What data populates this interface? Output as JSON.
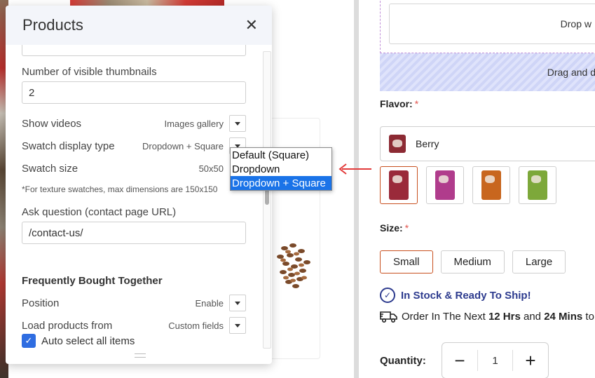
{
  "panel": {
    "title": "Products",
    "close_glyph": "✕",
    "thumbnails": {
      "label": "Number of visible thumbnails",
      "value": "2"
    },
    "show_videos": {
      "label": "Show videos",
      "value": "Images gallery"
    },
    "swatch_type": {
      "label": "Swatch display type",
      "value": "Dropdown + Square"
    },
    "swatch_size": {
      "label": "Swatch size",
      "value": "50x50"
    },
    "note": "*For texture swatches, max dimensions are 150x150",
    "ask_question": {
      "label": "Ask question (contact page URL)",
      "value": "/contact-us/"
    },
    "fbt": {
      "heading": "Frequently Bought Together",
      "position": {
        "label": "Position",
        "value": "Enable"
      },
      "load_from": {
        "label": "Load products from",
        "value": "Custom fields"
      },
      "auto_select": {
        "label": "Auto select all items",
        "checked": true
      }
    }
  },
  "dropdown": {
    "options": [
      "Default (Square)",
      "Dropdown",
      "Dropdown + Square"
    ],
    "selected_index": 2
  },
  "storefront": {
    "drop_text": "Drop w",
    "drag_text": "Drag and d",
    "flavor_label": "Flavor:",
    "required_mark": "*",
    "flavor_value": "Berry",
    "size_label": "Size:",
    "sizes": [
      "Small",
      "Medium",
      "Large"
    ],
    "selected_size": "Small",
    "stock_text": "In Stock & Ready To Ship!",
    "order": {
      "prefix": "Order In The Next",
      "hours": "12 Hrs",
      "and": "and",
      "mins": "24 Mins",
      "suffix": "to s"
    },
    "quantity_label": "Quantity:",
    "quantity_value": "1",
    "minus": "−",
    "plus": "+"
  },
  "colors": {
    "accent_blue": "#2f6de1",
    "selection_highlight": "#1a73e8",
    "arrow_red": "#e23b3b",
    "stock_blue": "#2d3b8e",
    "selected_border": "#c8501f",
    "swatch_colors": [
      "#9a2a3a",
      "#b03c8c",
      "#c8661e",
      "#7da83a"
    ]
  },
  "icons": [
    "close-icon",
    "chevron-down-icon",
    "checkmark-icon",
    "check-circle-icon",
    "truck-icon",
    "minus-icon",
    "plus-icon",
    "arrow-left-icon"
  ]
}
